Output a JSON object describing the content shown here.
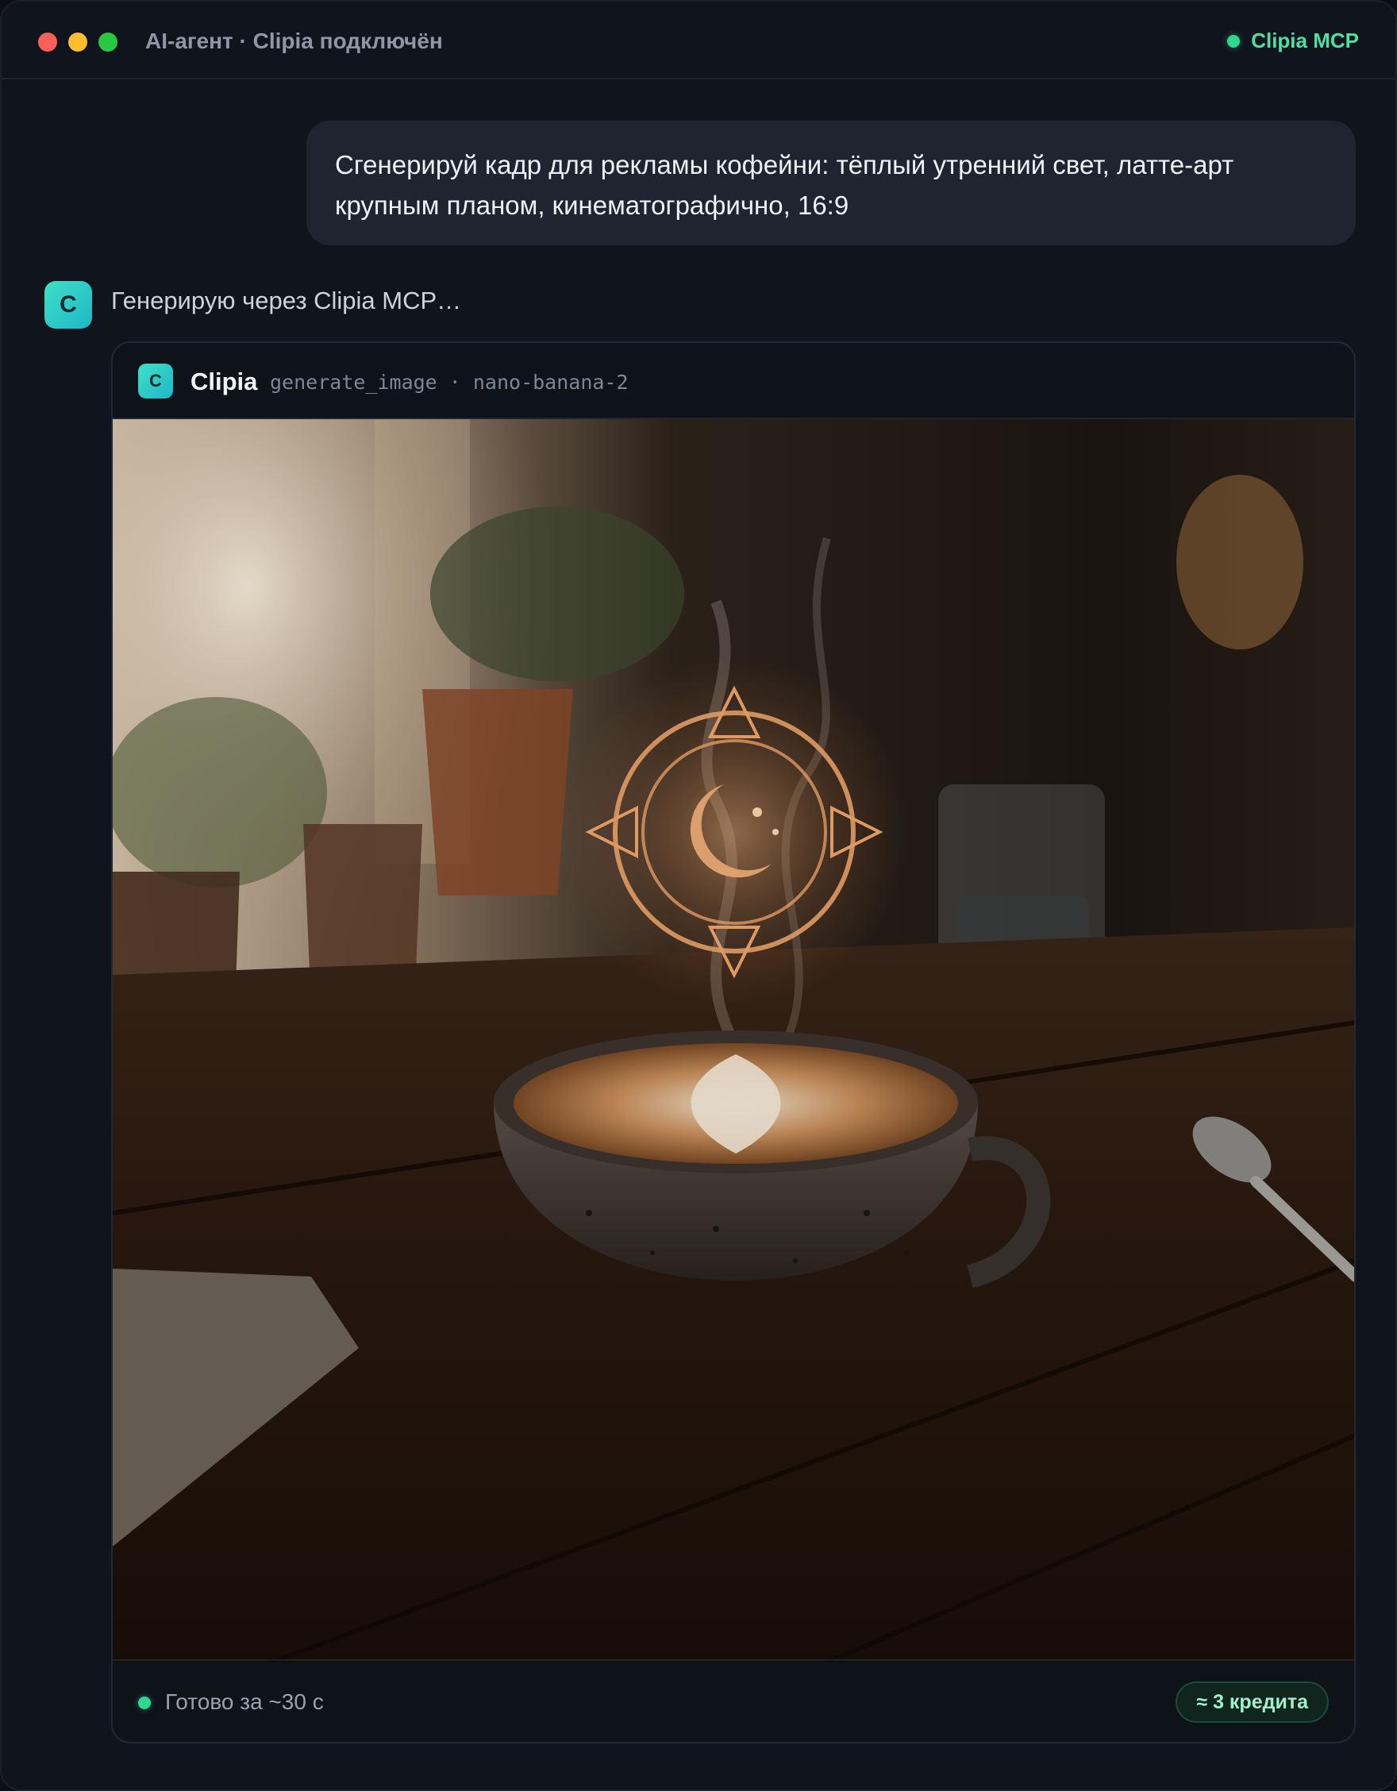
{
  "window": {
    "title": "AI-агент · Clipia подключён",
    "mcp_status": "Clipia MCP"
  },
  "user_message": {
    "text": "Сгенерируй кадр для рекламы кофейни: тёплый утренний свет, латте-арт крупным планом, кинематографично, 16:9"
  },
  "agent": {
    "avatar_letter": "C",
    "status": "Генерирую через Clipia MCP…"
  },
  "tool_card": {
    "logo_letter": "C",
    "brand": "Clipia",
    "tool": "generate_image · nano-banana-2",
    "image_description_icon": "generated-coffee-image",
    "ready_text": "Готово за ~30 с",
    "credits": "≈ 3 кредита"
  },
  "colors": {
    "accent": "#2fd68f",
    "brand_gradient_start": "#3ee0c6",
    "brand_gradient_end": "#1fb6c9",
    "bubble": "#1f2430"
  }
}
